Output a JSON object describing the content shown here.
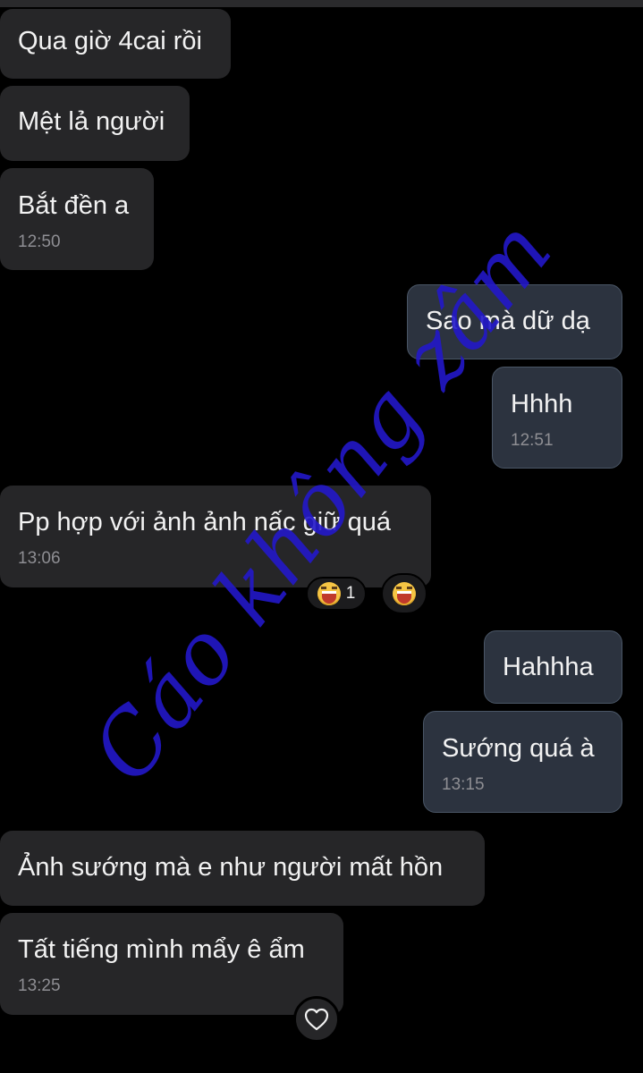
{
  "messages": [
    {
      "text": "Qua giờ 4cai rồi",
      "time": ""
    },
    {
      "text": "Mệt lả người",
      "time": ""
    },
    {
      "text": "Bắt đền a",
      "time": "12:50"
    },
    {
      "text": "Sao mà dữ dạ",
      "time": ""
    },
    {
      "text": "Hhhh",
      "time": "12:51"
    },
    {
      "text": "Pp hợp với ảnh ảnh nấc giữ quá",
      "time": "13:06"
    },
    {
      "text": "Hahhha",
      "time": ""
    },
    {
      "text": "Sướng quá à",
      "time": "13:15"
    },
    {
      "text": "Ảnh sướng mà e như người mất hồn",
      "time": ""
    },
    {
      "text": "Tất tiếng mình mẩy ê ẩm",
      "time": "13:25"
    }
  ],
  "reactions": {
    "laugh_count": "1",
    "laugh_icon": "laughing-face-emoji-icon",
    "heart_icon": "heart-outline-icon"
  },
  "watermark": "Cáo không zâm",
  "colors": {
    "background": "#000000",
    "incoming_bubble": "#262628",
    "outgoing_bubble": "#2c333f",
    "watermark": "#2318c9"
  }
}
